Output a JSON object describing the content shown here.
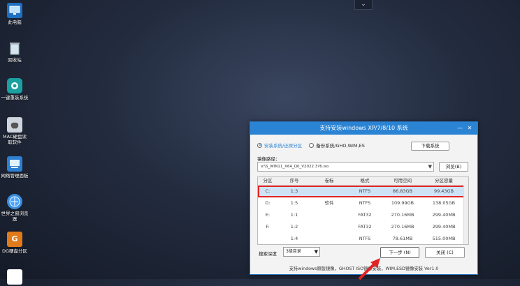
{
  "desktop": {
    "icons": [
      {
        "label": "此电脑",
        "icon": "computer-icon"
      },
      {
        "label": "回收站",
        "icon": "recycle-bin-icon"
      },
      {
        "label": "一键重装系统",
        "icon": "reinstall-icon"
      },
      {
        "label": "MAC硬盘读\n取软件",
        "icon": "apple-icon"
      },
      {
        "label": "网络管理面板",
        "icon": "network-icon"
      },
      {
        "label": "世界之窗浏览\n器",
        "icon": "browser-icon"
      },
      {
        "label": "DG硬盘分区",
        "icon": "dg-icon"
      }
    ],
    "top_chevron": "⌄"
  },
  "dialog": {
    "title": "支持安装windows XP/7/8/10 系统",
    "minimize": "—",
    "close": "✕",
    "mode_install": "安装系统/还原分区",
    "mode_backup": "备份系统/GHO,WIM,ES",
    "download_button": "下载系统",
    "path_label": "镜像路径：",
    "path_value": "V:\\S_WIN11_X64_Q0_V2022.3?6.iso",
    "browse_button": "浏览(B)",
    "table": {
      "headers": [
        "分区",
        "序号",
        "卷标",
        "格式",
        "可用空间",
        "分区容量"
      ],
      "rows": [
        [
          "C:",
          "1:3",
          "",
          "NTFS",
          "86.83GB",
          "99.43GB"
        ],
        [
          "D:",
          "1:5",
          "软件",
          "NTFS",
          "109.99GB",
          "138.05GB"
        ],
        [
          "E:",
          "1:1",
          "",
          "FAT32",
          "270.16MB",
          "299.40MB"
        ],
        [
          "F:",
          "1:2",
          "",
          "FAT32",
          "270.16MB",
          "299.40MB"
        ],
        [
          "",
          "1:4",
          "",
          "NTFS",
          "78.61MB",
          "515.00MB"
        ]
      ],
      "selected_row": 0
    },
    "depth_label": "搜索深度",
    "depth_value": "3级目录",
    "next_button": "下一步 (N)",
    "close_button": "关闭 (C)",
    "footer": "支持windows原版镜像，GHOST ISO镜像安装，WIM,ESD镜像安装 Ver1.0"
  },
  "colors": {
    "accent": "#2b83d4",
    "highlight_border": "#e02424"
  }
}
